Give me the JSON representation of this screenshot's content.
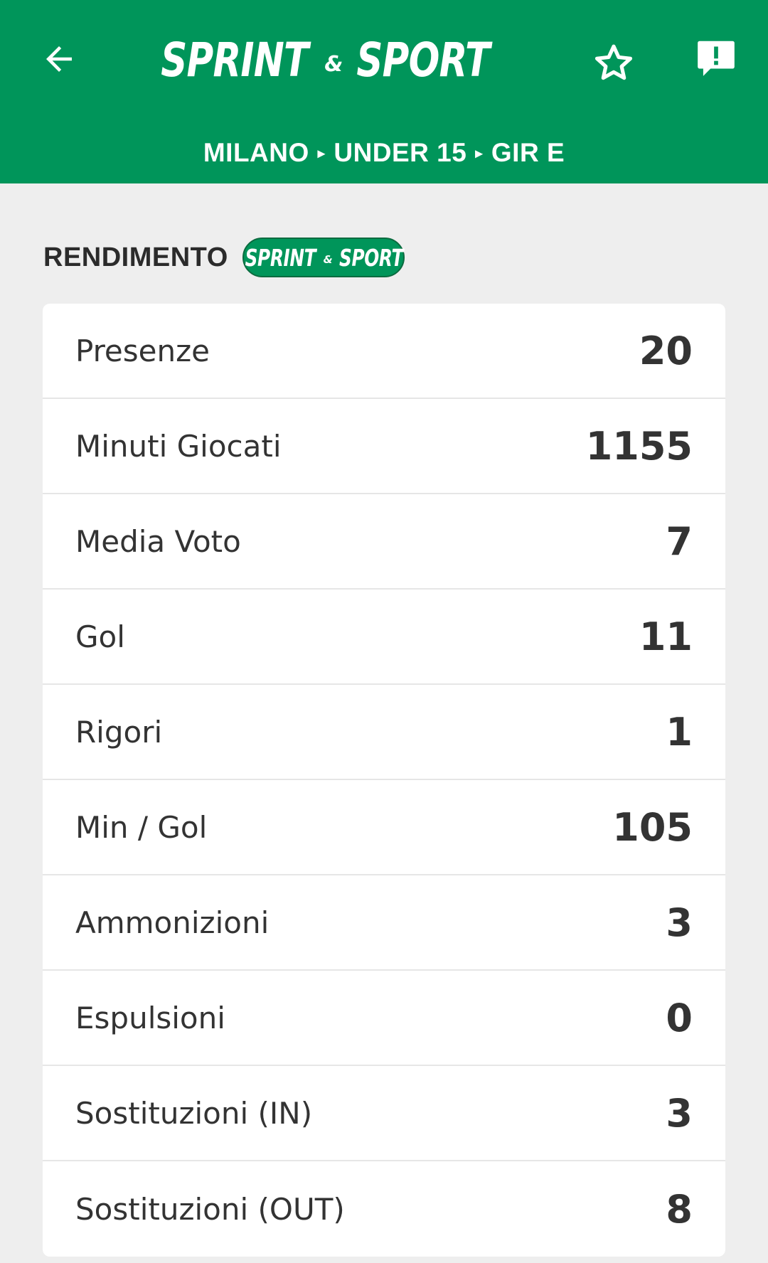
{
  "colors": {
    "header_bg": "#00955a",
    "page_bg": "#eeeeee",
    "card_bg": "#ffffff",
    "text": "#333333"
  },
  "header": {
    "back_icon": "arrow-left-icon",
    "logo_word_1": "SPRINT",
    "logo_amp": "&",
    "logo_word_2": "SPORT",
    "favorite_icon": "star-outline-icon",
    "report_icon": "report-bubble-icon",
    "breadcrumb": {
      "city": "MILANO",
      "category": "UNDER 15",
      "group": "GIR E",
      "separator": "▸"
    }
  },
  "section": {
    "title": "RENDIMENTO",
    "badge_word_1": "SPRINT",
    "badge_amp": "&",
    "badge_word_2": "SPORT"
  },
  "stats": [
    {
      "label": "Presenze",
      "value": "20"
    },
    {
      "label": "Minuti Giocati",
      "value": "1155"
    },
    {
      "label": "Media Voto",
      "value": "7"
    },
    {
      "label": "Gol",
      "value": "11"
    },
    {
      "label": "Rigori",
      "value": "1"
    },
    {
      "label": "Min / Gol",
      "value": "105"
    },
    {
      "label": "Ammonizioni",
      "value": "3"
    },
    {
      "label": "Espulsioni",
      "value": "0"
    },
    {
      "label": "Sostituzioni (IN)",
      "value": "3"
    },
    {
      "label": "Sostituzioni (OUT)",
      "value": "8"
    }
  ]
}
